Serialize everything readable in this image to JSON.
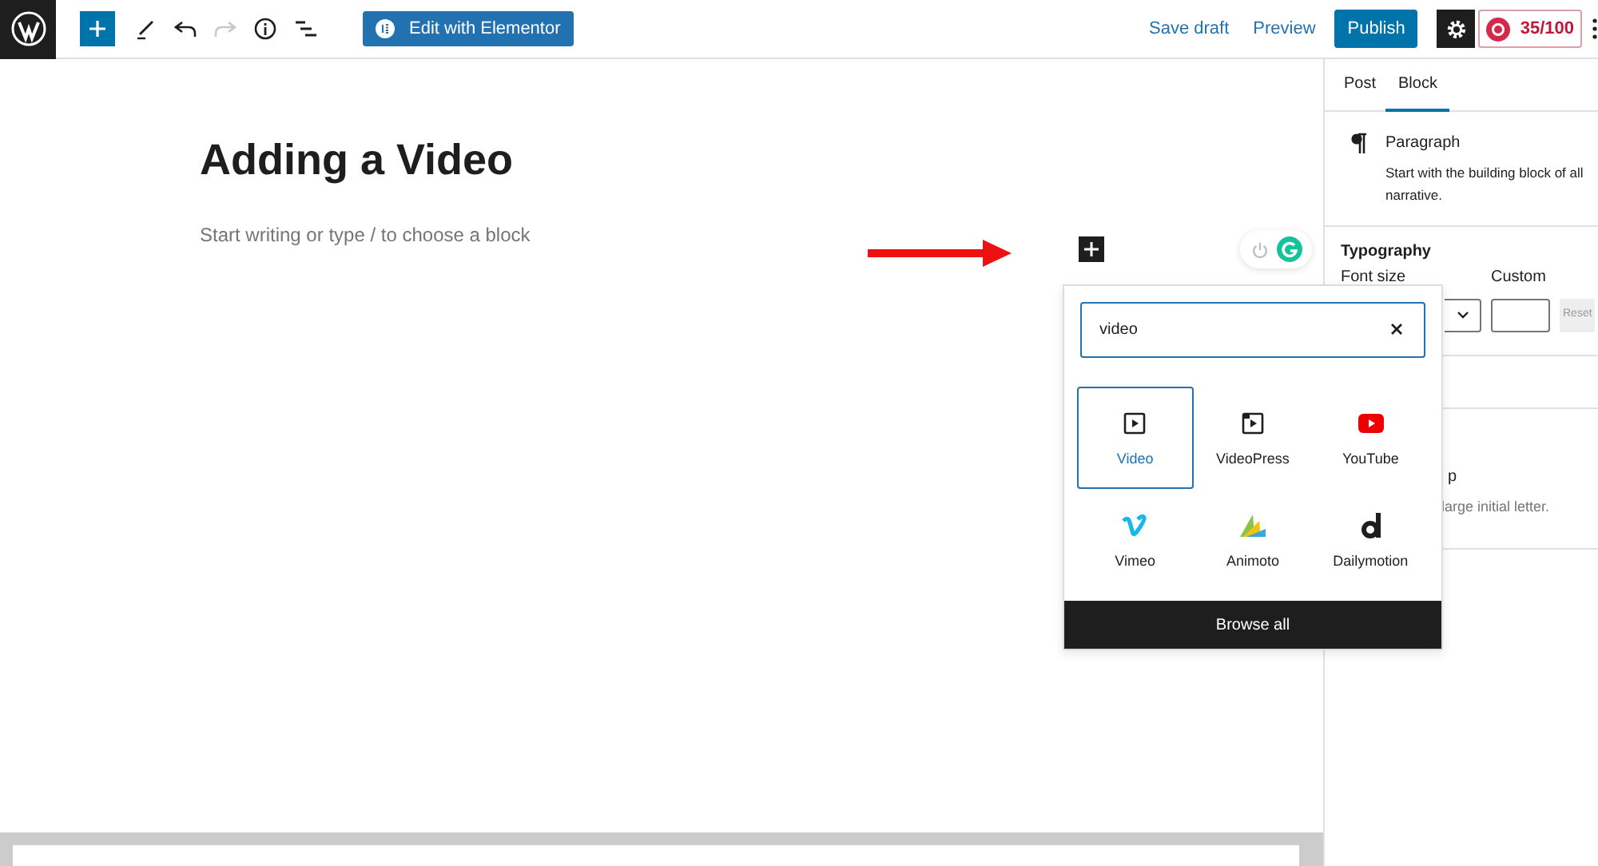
{
  "toolbar": {
    "edit_button": "Edit with Elementor",
    "save_draft": "Save draft",
    "preview": "Preview",
    "publish": "Publish",
    "score": "35/100"
  },
  "editor": {
    "title": "Adding a Video",
    "placeholder": "Start writing or type / to choose a block"
  },
  "inserter": {
    "search_value": "video",
    "blocks": [
      {
        "label": "Video",
        "kind": "video",
        "selected": true
      },
      {
        "label": "VideoPress",
        "kind": "videopress",
        "selected": false
      },
      {
        "label": "YouTube",
        "kind": "youtube",
        "selected": false
      },
      {
        "label": "Vimeo",
        "kind": "vimeo",
        "selected": false
      },
      {
        "label": "Animoto",
        "kind": "animoto",
        "selected": false
      },
      {
        "label": "Dailymotion",
        "kind": "dailymotion",
        "selected": false
      }
    ],
    "browse_all": "Browse all"
  },
  "sidebar": {
    "tabs": [
      {
        "label": "Post",
        "selected": false
      },
      {
        "label": "Block",
        "selected": true
      }
    ],
    "block_title": "Paragraph",
    "block_description": "Start with the building block of all narrative.",
    "typography": "Typography",
    "font_size_label": "Font size",
    "custom_label": "Custom",
    "reset": "Reset",
    "drop_cap_fragment": "p",
    "drop_cap_help_fragment": "large initial letter."
  }
}
